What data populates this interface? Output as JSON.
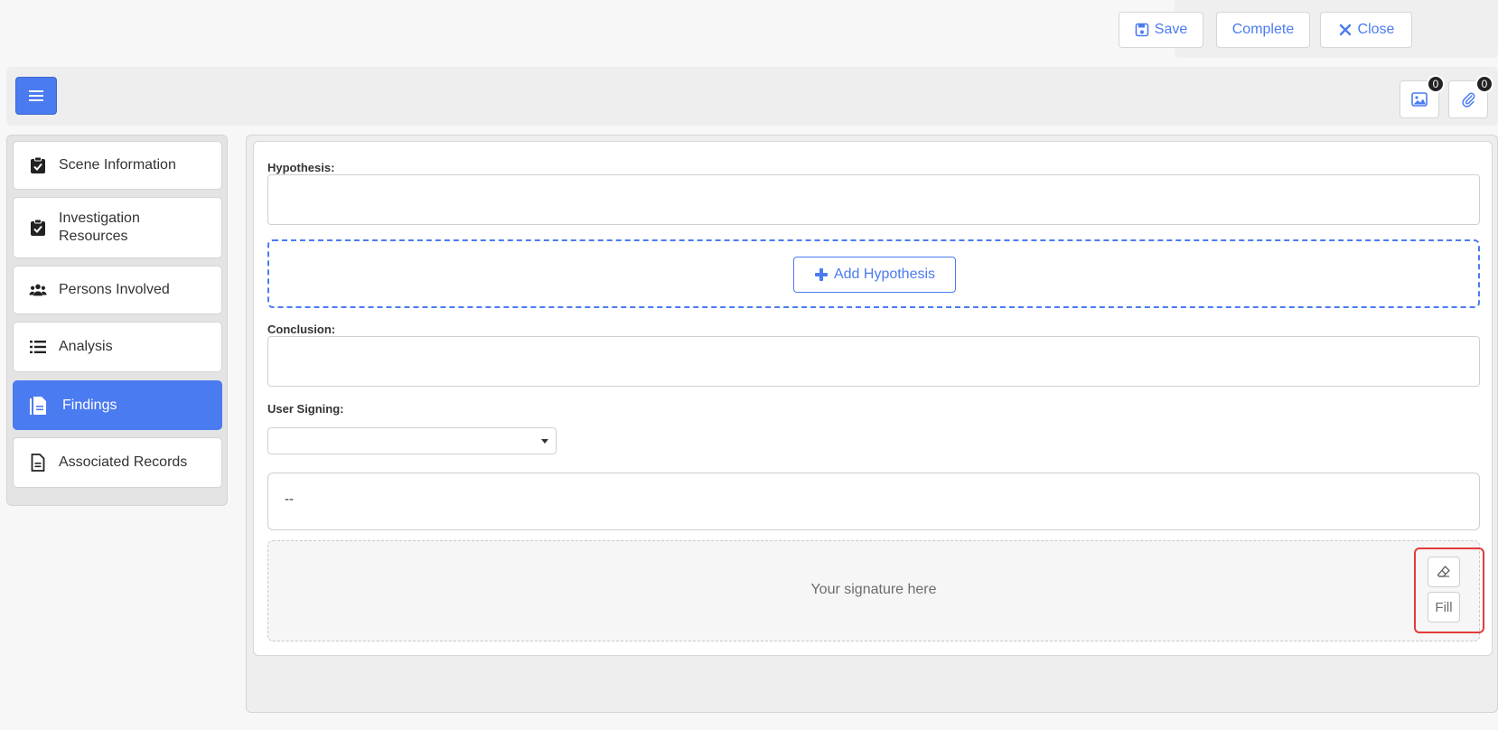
{
  "topbar": {
    "save_label": "Save",
    "complete_label": "Complete",
    "close_label": "Close"
  },
  "header": {
    "images_count": "0",
    "attachments_count": "0"
  },
  "sidebar": {
    "items": [
      {
        "label": "Scene Information",
        "icon": "clipboard-check-icon"
      },
      {
        "label": "Investigation Resources",
        "icon": "clipboard-check-icon"
      },
      {
        "label": "Persons Involved",
        "icon": "users-icon"
      },
      {
        "label": "Analysis",
        "icon": "list-icon"
      },
      {
        "label": "Findings",
        "icon": "file-document-icon",
        "active": true
      },
      {
        "label": "Associated Records",
        "icon": "file-icon"
      }
    ]
  },
  "form": {
    "hypothesis_label": "Hypothesis:",
    "add_hypothesis_label": "Add Hypothesis",
    "conclusion_label": "Conclusion:",
    "user_signing_label": "User Signing:",
    "signer_value": "--",
    "signature_placeholder": "Your signature here",
    "fill_label": "Fill"
  },
  "colors": {
    "accent": "#4b7bf0",
    "highlight": "#e33a3a"
  }
}
